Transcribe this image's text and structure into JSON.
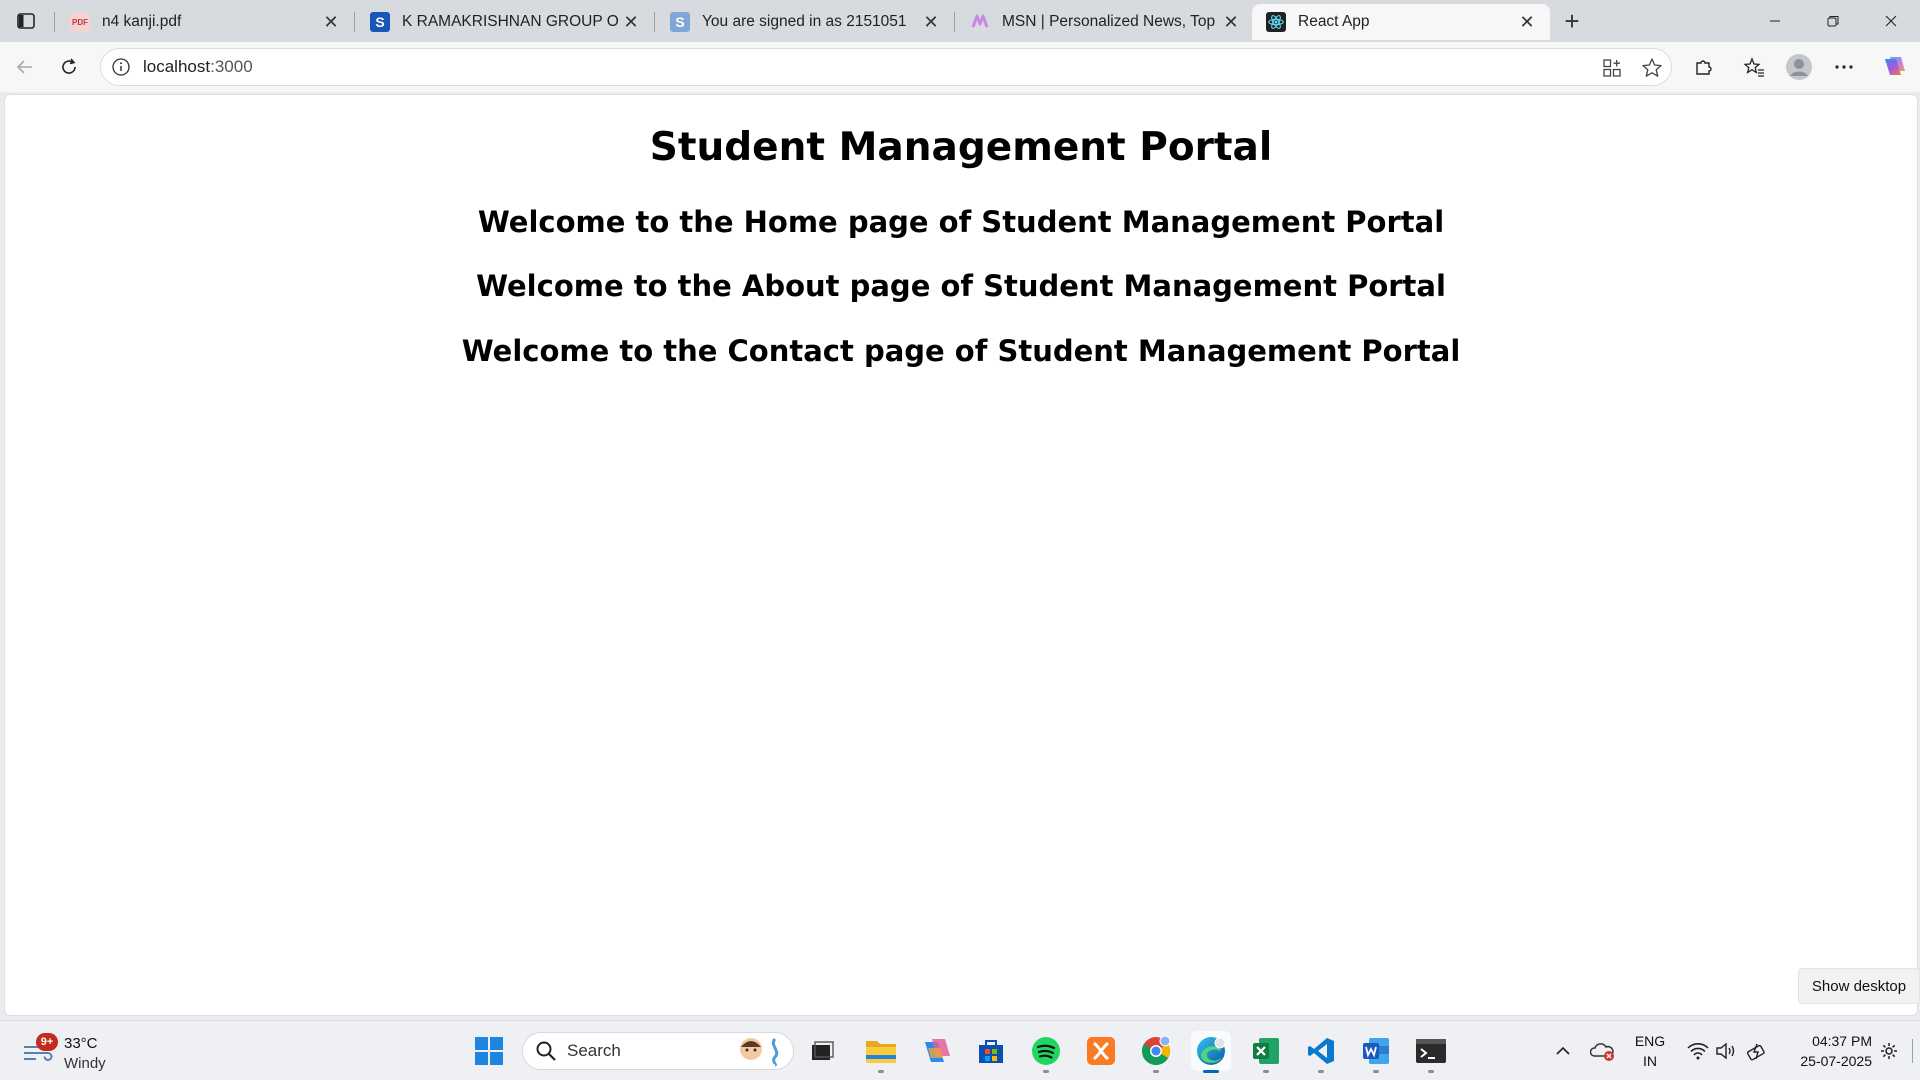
{
  "browser": {
    "tabs": [
      {
        "title": "n4 kanji.pdf",
        "icon": "pdf-icon",
        "active": false
      },
      {
        "title": "K RAMAKRISHNAN GROUP OF IN",
        "icon": "s-logo-icon",
        "active": false
      },
      {
        "title": "You are signed in as 2151051",
        "icon": "s-logo-icon",
        "active": false
      },
      {
        "title": "MSN | Personalized News, Top He",
        "icon": "msn-icon",
        "active": false
      },
      {
        "title": "React App",
        "icon": "react-icon",
        "active": true
      }
    ],
    "address": {
      "host": "localhost",
      "port": ":3000"
    }
  },
  "page": {
    "title": "Student Management Portal",
    "headings": [
      "Welcome to the Home page of Student Management Portal",
      "Welcome to the About page of Student Management Portal",
      "Welcome to the Contact page of Student Management Portal"
    ]
  },
  "show_desktop_label": "Show desktop",
  "taskbar": {
    "weather": {
      "badge": "9+",
      "temp": "33°C",
      "condition": "Windy"
    },
    "search_label": "Search",
    "apps": [
      "start-icon",
      "file-explorer-icon",
      "copilot-icon",
      "microsoft-store-icon",
      "spotify-icon",
      "xampp-icon",
      "chrome-icon",
      "edge-icon",
      "excel-icon",
      "vscode-icon",
      "word-icon",
      "terminal-icon"
    ],
    "language": {
      "line1": "ENG",
      "line2": "IN"
    },
    "clock": {
      "time": "04:37 PM",
      "date": "25-07-2025"
    }
  },
  "colors": {
    "accent": "#0067c0",
    "page_bg": "#ffffff"
  }
}
